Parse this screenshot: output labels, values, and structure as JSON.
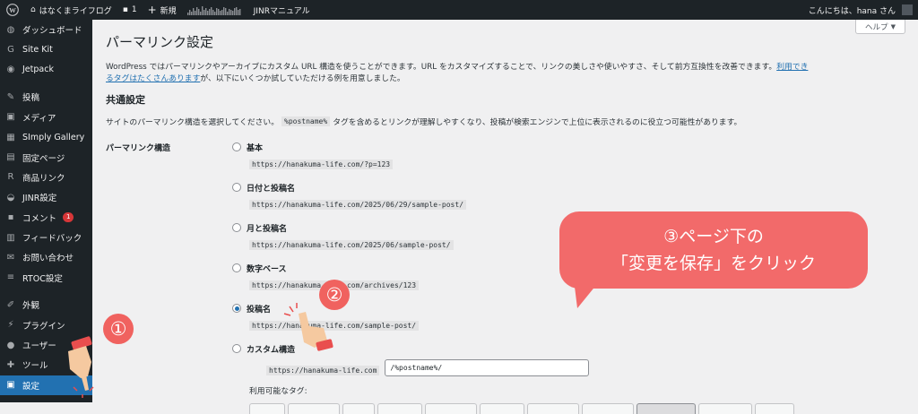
{
  "admin_bar": {
    "site_name": "はなくまライフログ",
    "comments_count": "1",
    "new_label": "新規",
    "jinr_manual": "JINRマニュアル",
    "greeting": "こんにちは、hana さん"
  },
  "sidebar": {
    "items": [
      {
        "icon": "dashboard-icon",
        "glyph": "◍",
        "label": "ダッシュボード"
      },
      {
        "icon": "sitekit-icon",
        "glyph": "G",
        "label": "Site Kit"
      },
      {
        "icon": "jetpack-icon",
        "glyph": "◉",
        "label": "Jetpack"
      },
      {
        "icon": "pin-icon",
        "glyph": "✎",
        "label": "投稿"
      },
      {
        "icon": "media-icon",
        "glyph": "▣",
        "label": "メディア"
      },
      {
        "icon": "gallery-icon",
        "glyph": "▦",
        "label": "SImply Gallery"
      },
      {
        "icon": "page-icon",
        "glyph": "▤",
        "label": "固定ページ"
      },
      {
        "icon": "rinker-icon",
        "glyph": "R",
        "label": "商品リンク"
      },
      {
        "icon": "jinr-icon",
        "glyph": "◒",
        "label": "JINR設定"
      },
      {
        "icon": "comment-icon",
        "glyph": "▪",
        "label": "コメント",
        "badge": "1"
      },
      {
        "icon": "feedback-icon",
        "glyph": "▥",
        "label": "フィードバック"
      },
      {
        "icon": "mail-icon",
        "glyph": "✉",
        "label": "お問い合わせ"
      },
      {
        "icon": "rtoc-icon",
        "glyph": "≡",
        "label": "RTOC設定"
      },
      {
        "icon": "appearance-icon",
        "glyph": "✐",
        "label": "外観"
      },
      {
        "icon": "plugin-icon",
        "glyph": "⚡",
        "label": "プラグイン"
      },
      {
        "icon": "user-icon",
        "glyph": "●",
        "label": "ユーザー"
      },
      {
        "icon": "tool-icon",
        "glyph": "✚",
        "label": "ツール"
      },
      {
        "icon": "settings-icon",
        "glyph": "▣",
        "label": "設定",
        "current": true
      }
    ]
  },
  "main": {
    "help_label": "ヘルプ",
    "title": "パーマリンク設定",
    "intro_text": "WordPress ではパーマリンクやアーカイブにカスタム URL 構造を使うことができます。URL をカスタマイズすることで、リンクの美しさや使いやすさ、そして前方互換性を改善できます。",
    "intro_link": "利用できるタグはたくさんあります",
    "intro_text2": "が、以下にいくつか試していただける例を用意しました。",
    "section_title": "共通設定",
    "desc_before": "サイトのパーマリンク構造を選択してください。",
    "desc_code": "%postname%",
    "desc_after": "タグを含めるとリンクが理解しやすくなり、投稿が検索エンジンで上位に表示されるのに役立つ可能性があります。",
    "form_label": "パーマリンク構造",
    "options": [
      {
        "label": "基本",
        "url": "https://hanakuma-life.com/?p=123",
        "checked": false
      },
      {
        "label": "日付と投稿名",
        "url": "https://hanakuma-life.com/2025/06/29/sample-post/",
        "checked": false
      },
      {
        "label": "月と投稿名",
        "url": "https://hanakuma-life.com/2025/06/sample-post/",
        "checked": false
      },
      {
        "label": "数字ベース",
        "url": "https://hanakuma-life.com/archives/123",
        "checked": false
      },
      {
        "label": "投稿名",
        "url": "https://hanakuma-life.com/sample-post/",
        "checked": true
      },
      {
        "label": "カスタム構造",
        "checked": false
      }
    ],
    "custom_base": "https://hanakuma-life.com",
    "custom_value": "/%postname%/",
    "available_tags_label": "利用可能なタグ:"
  },
  "annotations": {
    "step1": "①",
    "step2": "②",
    "callout_line1": "③ページ下の",
    "callout_line2": "「変更を保存」をクリック"
  },
  "colors": {
    "admin_bg": "#1d2327",
    "accent": "#2271b1",
    "callout": "#f26a6a",
    "badge": "#d63638"
  }
}
